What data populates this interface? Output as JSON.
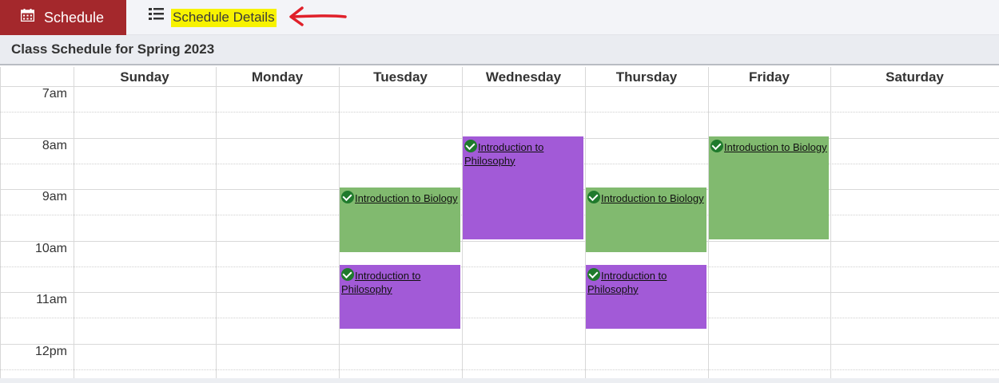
{
  "tabs": {
    "schedule_label": "Schedule",
    "details_label": "Schedule Details"
  },
  "title": "Class Schedule for Spring 2023",
  "days": [
    "Sunday",
    "Monday",
    "Tuesday",
    "Wednesday",
    "Thursday",
    "Friday",
    "Saturday"
  ],
  "times": [
    "7am",
    "8am",
    "9am",
    "10am",
    "11am",
    "12pm"
  ],
  "events": [
    {
      "title": "Introduction to Philosophy",
      "day": "Wednesday",
      "color": "#a25ad7"
    },
    {
      "title": "Introduction to Biology",
      "day": "Friday",
      "color": "#81ba6f"
    },
    {
      "title": "Introduction to Biology",
      "day": "Tuesday",
      "color": "#81ba6f"
    },
    {
      "title": "Introduction to Biology",
      "day": "Thursday",
      "color": "#81ba6f"
    },
    {
      "title": "Introduction to Philosophy",
      "day": "Tuesday",
      "color": "#a25ad7"
    },
    {
      "title": "Introduction to Philosophy",
      "day": "Thursday",
      "color": "#a25ad7"
    }
  ],
  "colors": {
    "tab_active": "#a4282c",
    "highlight": "#f7f200",
    "biology": "#81ba6f",
    "philosophy": "#a25ad7",
    "annotation_arrow": "#e0202a"
  }
}
